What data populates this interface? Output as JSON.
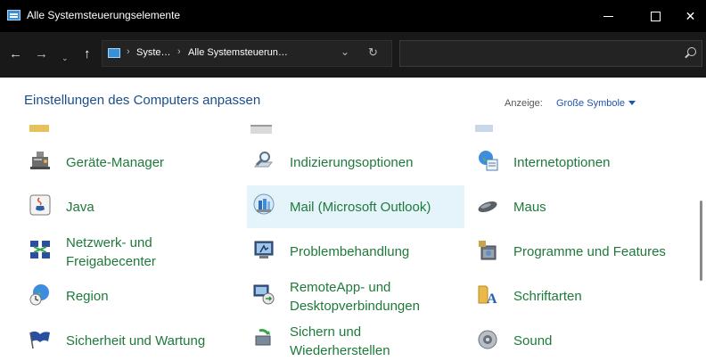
{
  "window": {
    "title": "Alle Systemsteuerungselemente",
    "minimize": "Minimieren",
    "maximize": "Maximieren",
    "close": "✕"
  },
  "nav": {
    "back": "←",
    "forward": "→",
    "recent": "⌄",
    "up": "↑",
    "breadcrumbs": [
      "Syste…",
      "Alle Systemsteuerun…"
    ],
    "separator": "›",
    "dropdown": "⌄",
    "refresh": "↻",
    "search_placeholder": ""
  },
  "header": {
    "title": "Einstellungen des Computers anpassen",
    "view_label": "Anzeige:",
    "view_value": "Große Symbole"
  },
  "items": [
    {
      "label": "Geräte-Manager",
      "icon": "device-manager-icon"
    },
    {
      "label": "Indizierungsoptionen",
      "icon": "indexing-options-icon"
    },
    {
      "label": "Internetoptionen",
      "icon": "internet-options-icon"
    },
    {
      "label": "Java",
      "icon": "java-icon"
    },
    {
      "label": "Mail (Microsoft Outlook)",
      "icon": "mail-icon"
    },
    {
      "label": "Maus",
      "icon": "mouse-icon"
    },
    {
      "label1": "Netzwerk- und",
      "label2": "Freigabecenter",
      "icon": "network-sharing-icon"
    },
    {
      "label": "Problembehandlung",
      "icon": "troubleshooting-icon"
    },
    {
      "label": "Programme und Features",
      "icon": "programs-features-icon"
    },
    {
      "label": "Region",
      "icon": "region-icon"
    },
    {
      "label1": "RemoteApp- und",
      "label2": "Desktopverbindungen",
      "icon": "remoteapp-icon"
    },
    {
      "label": "Schriftarten",
      "icon": "fonts-icon"
    },
    {
      "label": "Sicherheit und Wartung",
      "icon": "security-maintenance-icon"
    },
    {
      "label1": "Sichern und",
      "label2": "Wiederherstellen",
      "icon": "backup-restore-icon"
    },
    {
      "label": "Sound",
      "icon": "sound-icon"
    }
  ],
  "colors": {
    "title_bar": "#000000",
    "address_bar": "#191919",
    "link_green": "#1e7a3a",
    "header_blue": "#1a4e8a",
    "hover_bg": "#e5f3fb"
  }
}
